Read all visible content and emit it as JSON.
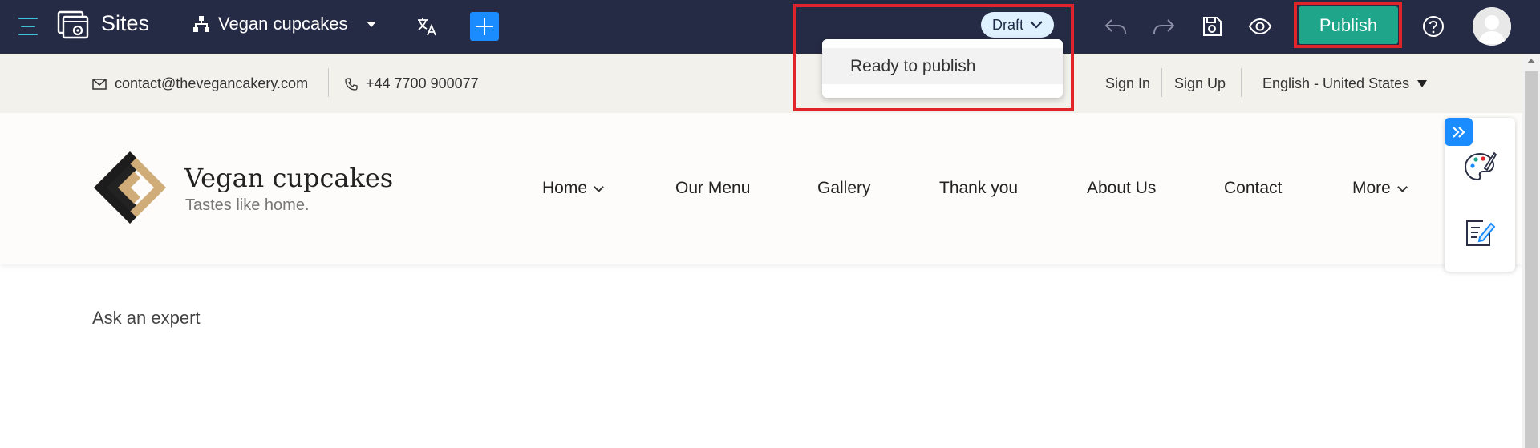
{
  "topbar": {
    "app_title": "Sites",
    "site_name": "Vegan cupcakes",
    "status_label": "Draft",
    "publish_label": "Publish"
  },
  "status_menu": {
    "options": [
      "Ready to publish"
    ]
  },
  "infobar": {
    "email": "contact@thevegancakery.com",
    "phone": "+44 7700 900077",
    "sign_in": "Sign In",
    "sign_up": "Sign Up",
    "language": "English - United States"
  },
  "site_header": {
    "brand_name": "Vegan cupcakes",
    "tagline": "Tastes like home.",
    "nav": [
      "Home",
      "Our Menu",
      "Gallery",
      "Thank you",
      "About Us",
      "Contact",
      "More"
    ]
  },
  "content": {
    "text": "Ask an expert"
  },
  "colors": {
    "topbar": "#262b45",
    "publish": "#1fa58a",
    "accent_blue": "#1a8cff",
    "highlight": "#e1232a",
    "draft_pill": "#dff1ff"
  },
  "icons": [
    "menu-icon",
    "sites-logo-icon",
    "sitemap-icon",
    "translate-icon",
    "plus-icon",
    "chevron-down-icon",
    "undo-icon",
    "redo-icon",
    "save-icon",
    "preview-eye-icon",
    "help-icon",
    "avatar",
    "mail-icon",
    "phone-icon",
    "double-chevron-right-icon",
    "palette-icon",
    "edit-content-icon"
  ]
}
